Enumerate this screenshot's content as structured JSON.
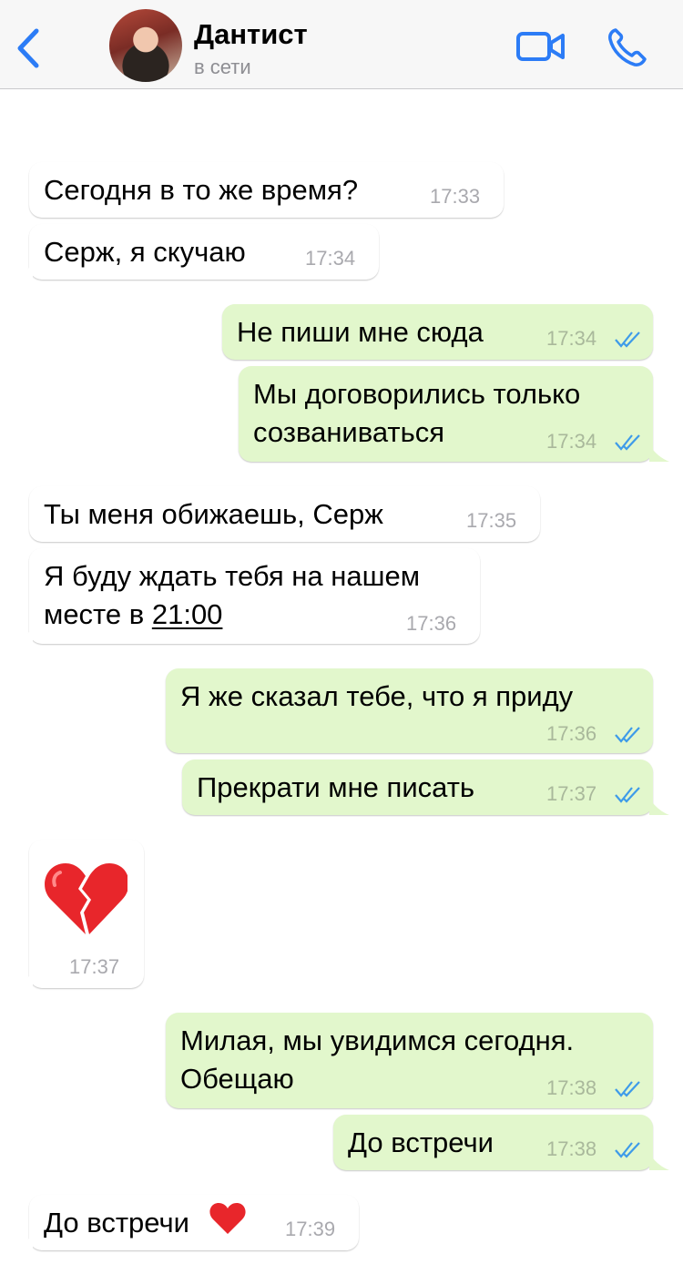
{
  "header": {
    "back_label": "back",
    "contact_name": "Дантист",
    "status": "в сети",
    "accent_color": "#2c7cf6"
  },
  "messages": [
    {
      "dir": "in",
      "lines": [
        "Сегодня в то же время?"
      ],
      "time": "17:33"
    },
    {
      "dir": "in",
      "lines": [
        "Серж, я скучаю"
      ],
      "time": "17:34"
    },
    {
      "dir": "out",
      "lines": [
        "Не пиши мне сюда"
      ],
      "time": "17:34",
      "status": "read"
    },
    {
      "dir": "out",
      "lines": [
        "Мы договорились только",
        "созваниваться"
      ],
      "time": "17:34",
      "status": "read"
    },
    {
      "dir": "in",
      "lines": [
        "Ты меня обижаешь, Серж"
      ],
      "time": "17:35"
    },
    {
      "dir": "in",
      "lines": [
        "Я буду ждать тебя на нашем",
        "месте в "
      ],
      "link": "21:00",
      "time": "17:36"
    },
    {
      "dir": "out",
      "lines": [
        "Я же сказал тебе, что я приду"
      ],
      "time": "17:36",
      "status": "read"
    },
    {
      "dir": "out",
      "lines": [
        "Прекрати мне писать"
      ],
      "time": "17:37",
      "status": "read"
    },
    {
      "dir": "in",
      "emoji": "broken-heart",
      "time": "17:37"
    },
    {
      "dir": "out",
      "lines": [
        "Милая, мы увидимся сегодня.",
        "Обещаю"
      ],
      "time": "17:38",
      "status": "read"
    },
    {
      "dir": "out",
      "lines": [
        "До встречи"
      ],
      "time": "17:38",
      "status": "read"
    },
    {
      "dir": "in",
      "lines": [
        "До встречи"
      ],
      "emoji_suffix": "red-heart",
      "time": "17:39"
    }
  ]
}
